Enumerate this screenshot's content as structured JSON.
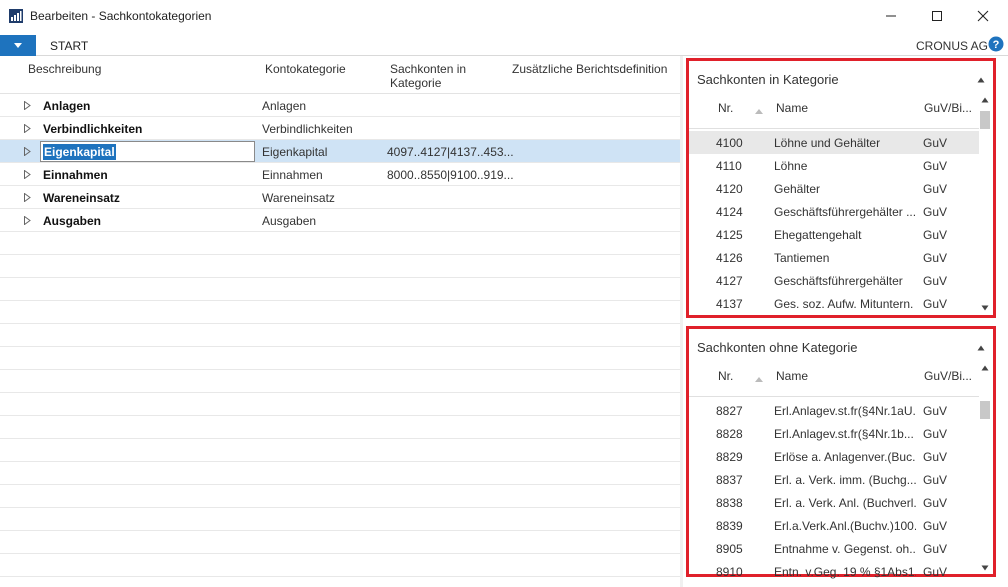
{
  "window": {
    "title": "Bearbeiten - Sachkontokategorien",
    "icons": [
      "app-icon",
      "minimize-icon",
      "maximize-icon",
      "close-icon"
    ]
  },
  "ribbon": {
    "tab": "START",
    "company": "CRONUS AG",
    "accent": "#1e73be"
  },
  "grid": {
    "headers": {
      "beschreibung": "Beschreibung",
      "kontokategorie": "Kontokategorie",
      "sachkonten": "Sachkonten in Kategorie",
      "zusaetzlich": "Zusätzliche Berichtsdefinition"
    },
    "rows": [
      {
        "desc": "Anlagen",
        "cat": "Anlagen",
        "sach": ""
      },
      {
        "desc": "Verbindlichkeiten",
        "cat": "Verbindlichkeiten",
        "sach": ""
      },
      {
        "desc": "Eigenkapital",
        "cat": "Eigenkapital",
        "sach": "4097..4127|4137..453..."
      },
      {
        "desc": "Einnahmen",
        "cat": "Einnahmen",
        "sach": "8000..8550|9100..919..."
      },
      {
        "desc": "Wareneinsatz",
        "cat": "Wareneinsatz",
        "sach": ""
      },
      {
        "desc": "Ausgaben",
        "cat": "Ausgaben",
        "sach": ""
      }
    ],
    "selected_index": 2,
    "selection_color": "#cfe3f5"
  },
  "panel_in": {
    "title": "Sachkonten in Kategorie",
    "col_nr": "Nr.",
    "col_name": "Name",
    "col_guv": "GuV/Bi...",
    "rows": [
      {
        "nr": "4100",
        "name": "Löhne und Gehälter",
        "guv": "GuV"
      },
      {
        "nr": "4110",
        "name": "Löhne",
        "guv": "GuV"
      },
      {
        "nr": "4120",
        "name": "Gehälter",
        "guv": "GuV"
      },
      {
        "nr": "4124",
        "name": "Geschäftsführergehälter ...",
        "guv": "GuV"
      },
      {
        "nr": "4125",
        "name": "Ehegattengehalt",
        "guv": "GuV"
      },
      {
        "nr": "4126",
        "name": "Tantiemen",
        "guv": "GuV"
      },
      {
        "nr": "4127",
        "name": "Geschäftsführergehälter",
        "guv": "GuV"
      },
      {
        "nr": "4137",
        "name": "Ges. soz. Aufw. Mituntern.",
        "guv": "GuV"
      }
    ]
  },
  "panel_out": {
    "title": "Sachkonten ohne Kategorie",
    "col_nr": "Nr.",
    "col_name": "Name",
    "col_guv": "GuV/Bi...",
    "rows": [
      {
        "nr": "8827",
        "name": "Erl.Anlagev.st.fr(§4Nr.1aU...",
        "guv": "GuV"
      },
      {
        "nr": "8828",
        "name": "Erl.Anlagev.st.fr(§4Nr.1b...",
        "guv": "GuV"
      },
      {
        "nr": "8829",
        "name": "Erlöse a. Anlagenver.(Buc...",
        "guv": "GuV"
      },
      {
        "nr": "8837",
        "name": "Erl. a. Verk. imm. (Buchg...",
        "guv": "GuV"
      },
      {
        "nr": "8838",
        "name": "Erl. a. Verk. Anl. (Buchverl.)",
        "guv": "GuV"
      },
      {
        "nr": "8839",
        "name": "Erl.a.Verk.Anl.(Buchv.)100...",
        "guv": "GuV"
      },
      {
        "nr": "8905",
        "name": "Entnahme v. Gegenst. oh...",
        "guv": "GuV"
      },
      {
        "nr": "8910",
        "name": "Entn. v.Geg. 19 % §1Abs1...",
        "guv": "GuV"
      }
    ]
  },
  "highlight_color": "#e0202a"
}
